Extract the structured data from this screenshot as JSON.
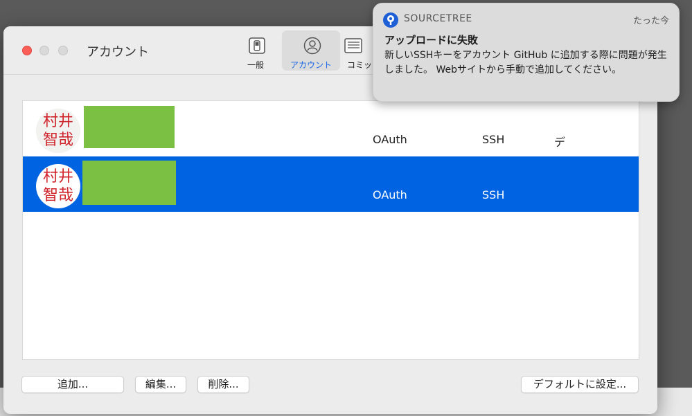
{
  "window": {
    "title": "アカウント",
    "toolbar": [
      {
        "label": "一般",
        "icon": "general-switch-icon",
        "active": false
      },
      {
        "label": "アカウント",
        "icon": "account-icon",
        "active": true
      },
      {
        "label": "コミッ",
        "icon": "commit-doc-icon",
        "active": false
      }
    ]
  },
  "accounts": [
    {
      "avatar_line1": "村井",
      "avatar_line2": "智哉",
      "auth": "OAuth",
      "protocol": "SSH",
      "default": "デ",
      "selected": false
    },
    {
      "avatar_line1": "村井",
      "avatar_line2": "智哉",
      "auth": "OAuth",
      "protocol": "SSH",
      "default": "",
      "selected": true
    }
  ],
  "buttons": {
    "add": "追加...",
    "edit": "編集...",
    "delete": "削除...",
    "set_default": "デフォルトに設定..."
  },
  "notification": {
    "app_name": "SOURCETREE",
    "time": "たった今",
    "title": "アップロードに失敗",
    "body": "新しいSSHキーをアカウント GitHub に追加する際に問題が発生しました。 Webサイトから手動で追加してください。"
  },
  "colors": {
    "selection": "#0063e1",
    "accent": "#1c6ae4",
    "close_light": "#fd5f57",
    "redaction": "#7bbf43",
    "stamp_red": "#d0262e"
  }
}
